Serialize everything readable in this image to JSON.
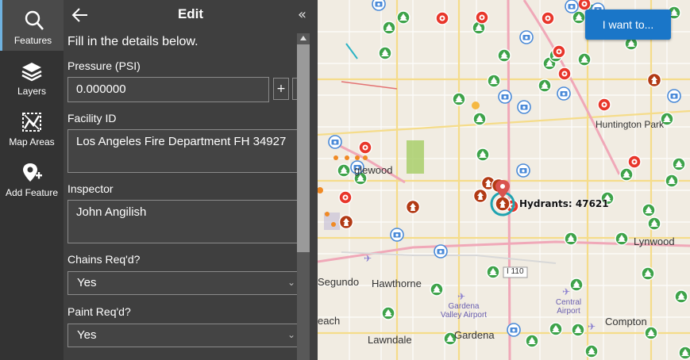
{
  "rail": {
    "items": [
      {
        "label": "Features",
        "icon": "search-icon",
        "active": true
      },
      {
        "label": "Layers",
        "icon": "layers-icon"
      },
      {
        "label": "Map Areas",
        "icon": "map-areas-icon"
      },
      {
        "label": "Add Feature",
        "icon": "add-feature-icon"
      }
    ]
  },
  "panel": {
    "title": "Edit",
    "back_icon": "arrow-left-icon",
    "collapse_label": "«",
    "intro": "Fill in the details below.",
    "fields": {
      "pressure": {
        "label": "Pressure (PSI)",
        "value": "0.000000",
        "plus": "+",
        "minus": "-"
      },
      "facility_id": {
        "label": "Facility ID",
        "value": "Los Angeles Fire Department FH 34927"
      },
      "inspector": {
        "label": "Inspector",
        "value": "John Angilish"
      },
      "chains": {
        "label": "Chains Req'd?",
        "value": "Yes"
      },
      "paint": {
        "label": "Paint Req'd?",
        "value": "Yes"
      }
    }
  },
  "map": {
    "button": "I want to...",
    "hydrant_label": "Hydrants: 47621",
    "places": [
      "Huntington Park",
      "glewood",
      "Lynwood",
      "Segundo",
      "Hawthorne",
      "Gardena Valley Airport",
      "Central Airport",
      "each",
      "Gardena",
      "Compton",
      "Lawndale",
      "I 110"
    ],
    "colors": {
      "accent": "#1a76c8",
      "hydrant_red": "#e8362a",
      "tree_green": "#3ea34a",
      "camera_blue": "#4a8ad8",
      "fire_dark": "#b23a14"
    }
  }
}
